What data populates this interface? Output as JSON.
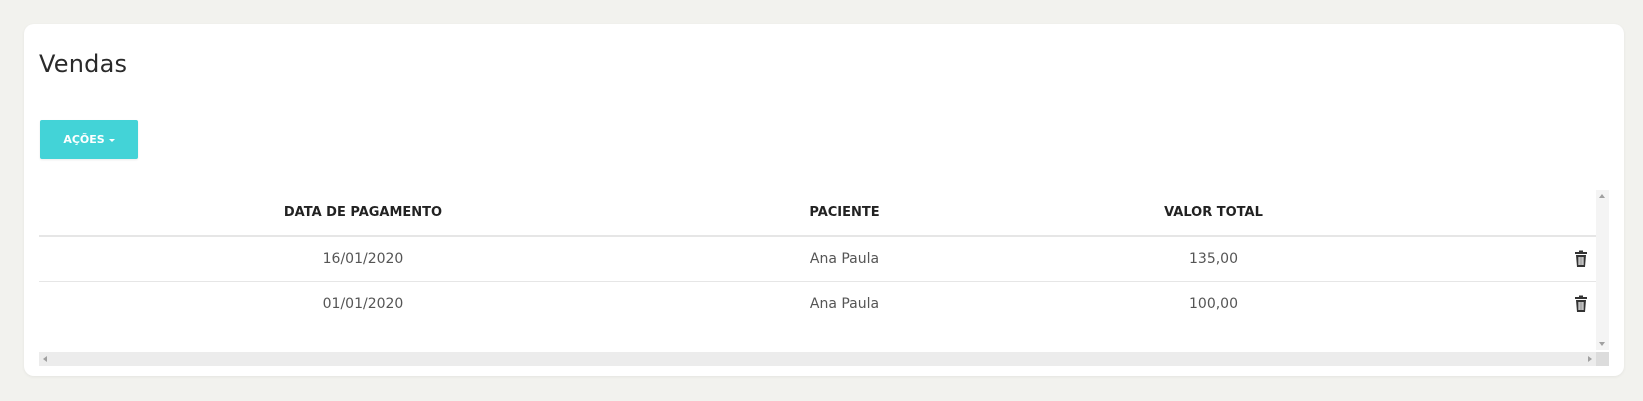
{
  "page": {
    "title": "Vendas"
  },
  "actions": {
    "label": "AÇÕES"
  },
  "table": {
    "headers": {
      "payment_date": "DATA DE PAGAMENTO",
      "patient": "PACIENTE",
      "total_value": "VALOR TOTAL"
    },
    "rows": [
      {
        "payment_date": "16/01/2020",
        "patient": "Ana Paula",
        "total_value": "135,00"
      },
      {
        "payment_date": "01/01/2020",
        "patient": "Ana Paula",
        "total_value": "100,00"
      }
    ]
  },
  "icons": {
    "row_action": "trash-icon",
    "dropdown": "caret-down-icon"
  },
  "colors": {
    "accent": "#43d3d7",
    "background": "#f2f2ee"
  }
}
